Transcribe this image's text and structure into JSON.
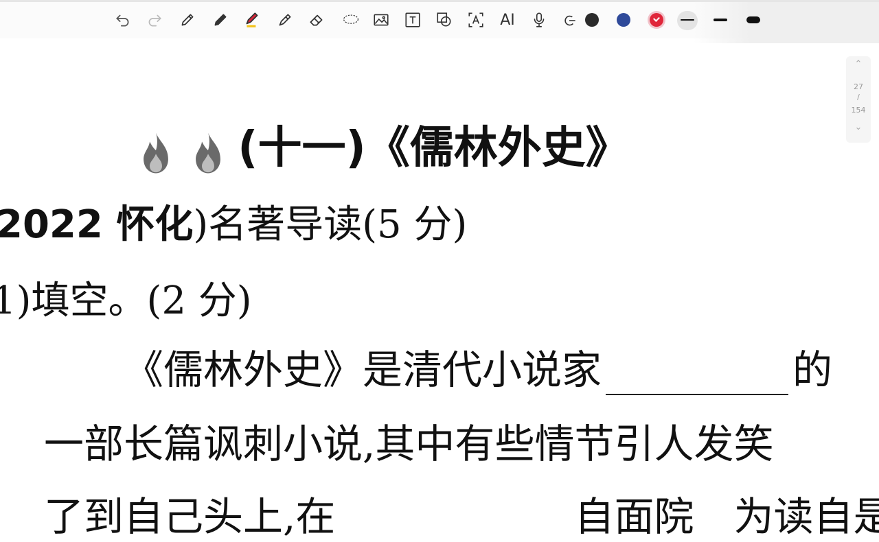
{
  "toolbar": {
    "tools": [
      {
        "name": "undo-icon"
      },
      {
        "name": "redo-icon"
      },
      {
        "name": "pen-icon"
      },
      {
        "name": "pencil-icon"
      },
      {
        "name": "highlighter-icon"
      },
      {
        "name": "marker-icon"
      },
      {
        "name": "eraser-icon"
      },
      {
        "name": "lasso-icon"
      },
      {
        "name": "image-icon"
      },
      {
        "name": "text-box-icon"
      },
      {
        "name": "shape-icon"
      },
      {
        "name": "text-recognition-icon"
      },
      {
        "name": "ai-label",
        "label": "AI"
      },
      {
        "name": "microphone-icon"
      },
      {
        "name": "link-icon"
      }
    ],
    "colors": {
      "black": "#2b2b2b",
      "blue": "#2f4a9a",
      "red": "#e0263a",
      "highlighter_accent": "#f2c21b"
    },
    "selected_color": "red",
    "stroke_widths": [
      "thin",
      "medium",
      "thick"
    ],
    "selected_stroke": "thin"
  },
  "scroller": {
    "current_page": "27",
    "separator": "/",
    "total_pages": "154"
  },
  "document": {
    "title": "(十一)《儒林外史》",
    "question_bold": "2022 怀化",
    "question_rest": ")名著导读(5 分)",
    "subquestion": "1)填空。(2 分)",
    "para1_before_blank": "《儒林外史》是清代小说家",
    "para1_after_blank": "的",
    "para2": "一部长篇讽刺小说,其中有些情节引人发笑",
    "para3": "了到自己头上,在　　　　　　自面院　为读自是"
  }
}
